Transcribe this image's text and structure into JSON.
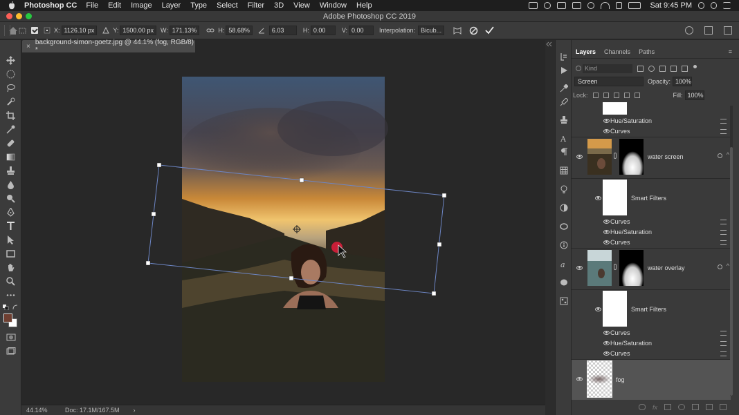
{
  "menubar": {
    "app_name": "Photoshop CC",
    "items": [
      "File",
      "Edit",
      "Image",
      "Layer",
      "Type",
      "Select",
      "Filter",
      "3D",
      "View",
      "Window",
      "Help"
    ],
    "clock": "Sat 9:45 PM"
  },
  "window": {
    "title": "Adobe Photoshop CC 2019",
    "doc_tab": "background-simon-goetz.jpg @ 44.1% (fog, RGB/8) *"
  },
  "options": {
    "x_label": "X:",
    "x_value": "1126.10 px",
    "y_label": "Y:",
    "y_value": "1500.00 px",
    "w_label": "W:",
    "w_value": "171.13%",
    "h_label": "H:",
    "h_value": "58.68%",
    "angle_value": "6.03",
    "hskew_label": "H:",
    "hskew_value": "0.00",
    "vskew_label": "V:",
    "vskew_value": "0.00",
    "interp_label": "Interpolation:",
    "interp_value": "Bicub..."
  },
  "status": {
    "zoom": "44.14%",
    "doc": "Doc: 17.1M/167.5M"
  },
  "layers_panel": {
    "tabs": [
      "Layers",
      "Channels",
      "Paths"
    ],
    "kind_placeholder": "Kind",
    "blend_mode": "Screen",
    "opacity_label": "Opacity:",
    "opacity_value": "100%",
    "lock_label": "Lock:",
    "fill_label": "Fill:",
    "fill_value": "100%",
    "rows": {
      "huesat1": "Hue/Saturation",
      "curves1": "Curves",
      "water_screen": "water screen",
      "smart_filters1": "Smart Filters",
      "curves2": "Curves",
      "huesat2": "Hue/Saturation",
      "curves3": "Curves",
      "water_overlay": "water overlay",
      "smart_filters2": "Smart Filters",
      "curves4": "Curves",
      "huesat3": "Hue/Saturation",
      "curves5": "Curves",
      "fog": "fog"
    }
  }
}
